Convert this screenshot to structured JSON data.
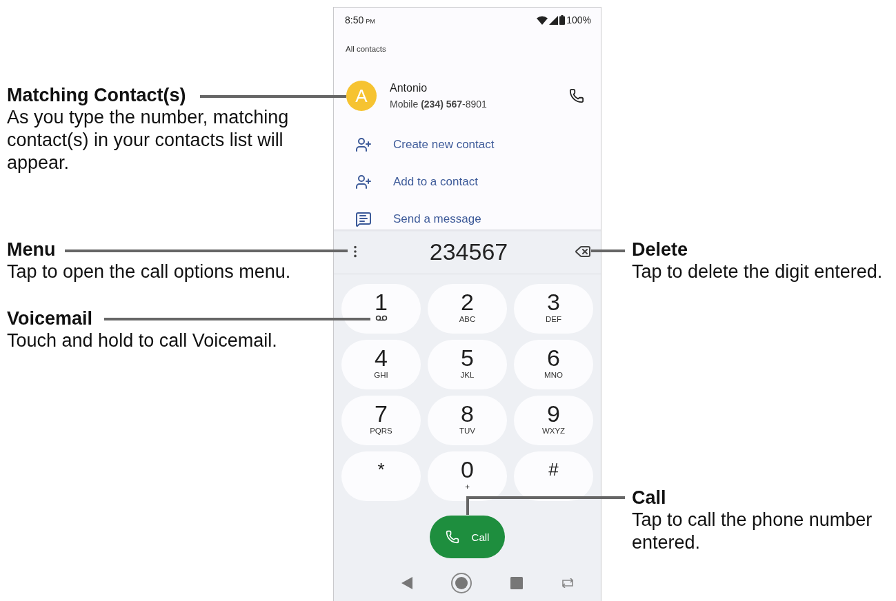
{
  "phone": {
    "status_bar": {
      "time": "8:50",
      "time_suffix": "PM",
      "battery": "100%"
    },
    "section_title": "All contacts",
    "contact": {
      "initial": "A",
      "name": "Antonio",
      "detail": "Mobile **(234) 567**-8901"
    },
    "actions": [
      {
        "kind": "add-person",
        "label": "Create new contact"
      },
      {
        "kind": "add-person",
        "label": "Add to a contact"
      },
      {
        "kind": "message",
        "label": "Send a message"
      }
    ],
    "dialed_number": "234567",
    "keys": [
      {
        "digit": "1",
        "kind": "voicemail"
      },
      {
        "digit": "2",
        "letters": "ABC"
      },
      {
        "digit": "3",
        "letters": "DEF"
      },
      {
        "digit": "4",
        "letters": "GHI"
      },
      {
        "digit": "5",
        "letters": "JKL"
      },
      {
        "digit": "6",
        "letters": "MNO"
      },
      {
        "digit": "7",
        "letters": "PQRS"
      },
      {
        "digit": "8",
        "letters": "TUV"
      },
      {
        "digit": "9",
        "letters": "WXYZ"
      },
      {
        "digit": "*"
      },
      {
        "digit": "0",
        "letters": "+"
      },
      {
        "digit": "#"
      }
    ],
    "call_button": "Call"
  },
  "callouts": [
    {
      "title": "Matching Contact(s)",
      "text": "As you type the number, matching contact(s) in your contacts list will appear."
    },
    {
      "title": "Menu",
      "text": "Tap to open the call options menu."
    },
    {
      "title": "Voicemail",
      "text": "Touch and hold to call Voicemail."
    },
    {
      "title": "Delete",
      "text": "Tap to delete the digit entered."
    },
    {
      "title": "Call",
      "text": "Tap to call the phone number entered."
    }
  ]
}
